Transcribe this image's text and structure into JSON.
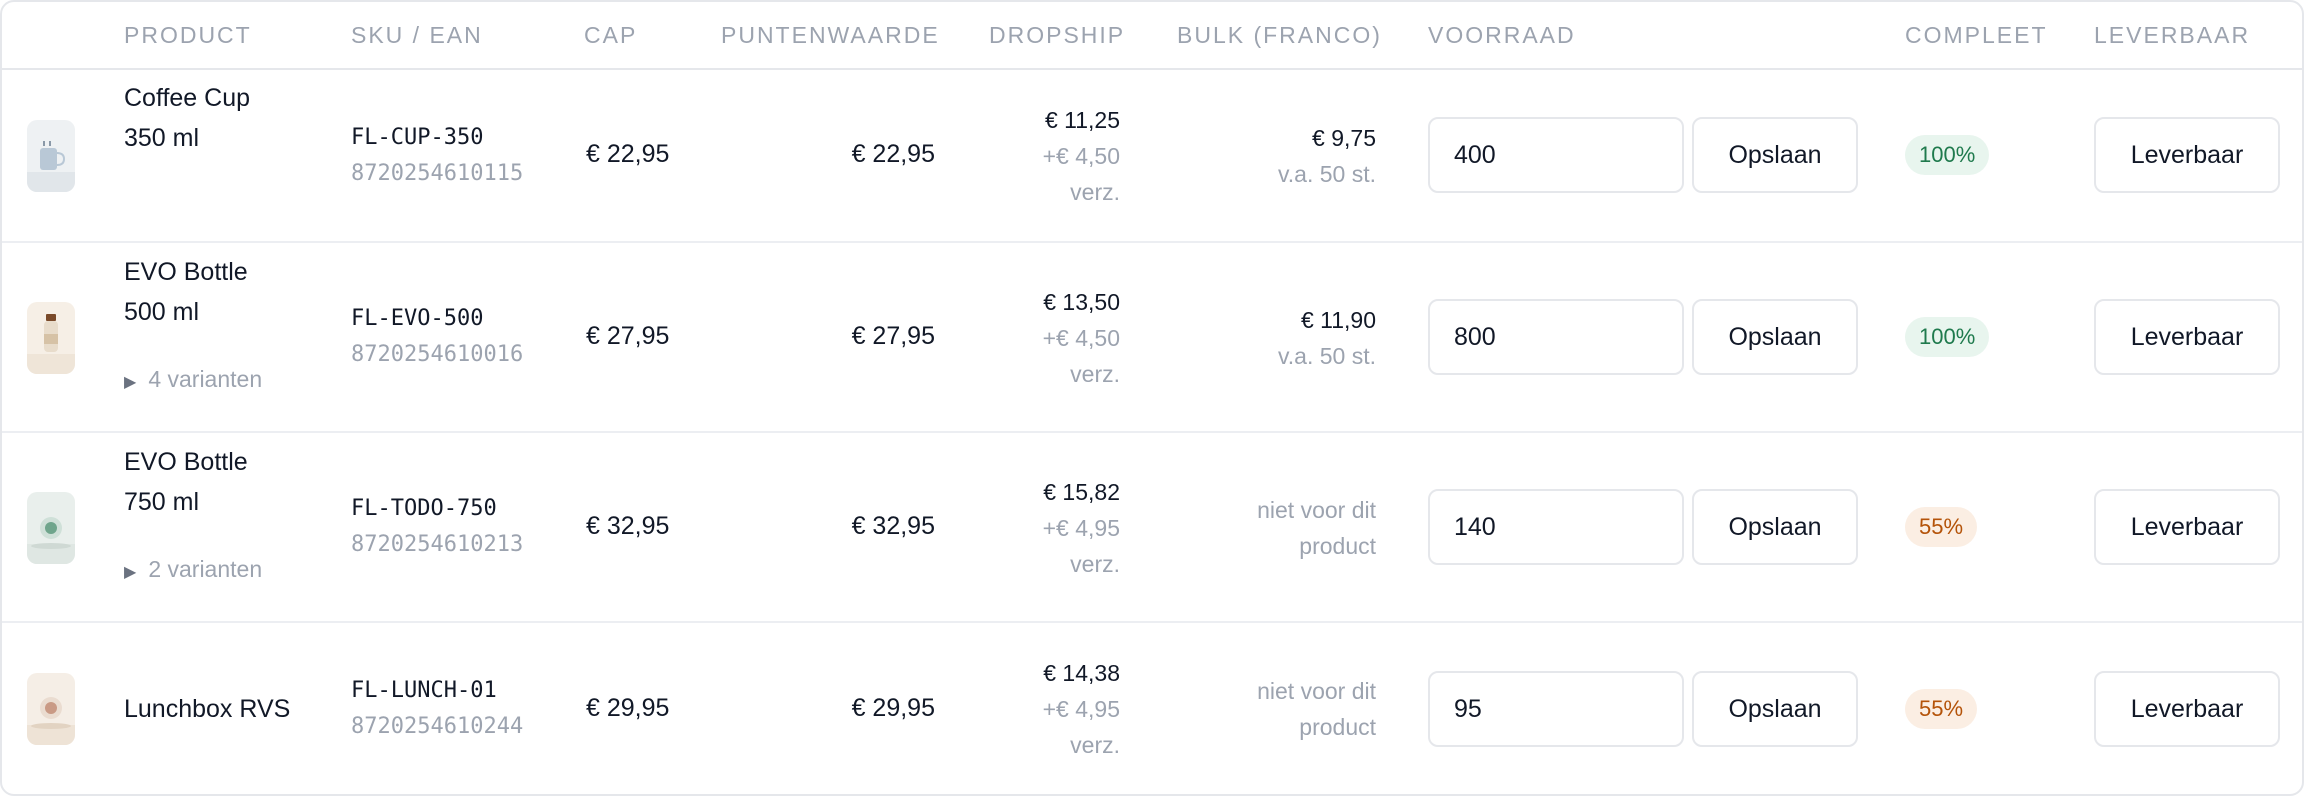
{
  "colors": {
    "header_text": "#9ca3af",
    "badge_complete_bg": "#e8f5ee",
    "badge_complete_text": "#1f7a4d",
    "badge_partial_bg": "#fbeee3",
    "badge_partial_text": "#b45309"
  },
  "header": {
    "product": "PRODUCT",
    "sku": "SKU / EAN",
    "cap": "CAP",
    "points": "PUNTENWAARDE",
    "dropship": "DROPSHIP",
    "bulk": "BULK (FRANCO)",
    "stock": "VOORRAAD",
    "complete": "COMPLEET",
    "available": "LEVERBAAR"
  },
  "rows": [
    {
      "thumb_icon": "coffee-cup-icon",
      "name_line1": "Coffee Cup",
      "name_line2": "350 ml",
      "variants": "",
      "sku": "FL-CUP-350",
      "ean": "8720254610115",
      "cap": "€ 22,95",
      "points": "€ 22,95",
      "dropship_price": "€ 11,25",
      "dropship_ship": "+€ 4,50",
      "dropship_ship2": "verz.",
      "bulk_line1": "€ 9,75",
      "bulk_line2": "v.a. 50 st.",
      "stock": "400",
      "save_label": "Opslaan",
      "complete": "100%",
      "complete_state": "full",
      "available_label": "Leverbaar"
    },
    {
      "thumb_icon": "bottle-icon",
      "name_line1": "EVO Bottle",
      "name_line2": "500 ml",
      "variants": "4 varianten",
      "sku": "FL-EVO-500",
      "ean": "8720254610016",
      "cap": "€ 27,95",
      "points": "€ 27,95",
      "dropship_price": "€ 13,50",
      "dropship_ship": "+€ 4,50",
      "dropship_ship2": "verz.",
      "bulk_line1": "€ 11,90",
      "bulk_line2": "v.a. 50 st.",
      "stock": "800",
      "save_label": "Opslaan",
      "complete": "100%",
      "complete_state": "full",
      "available_label": "Leverbaar"
    },
    {
      "thumb_icon": "bottle-top-view-icon",
      "name_line1": "EVO Bottle",
      "name_line2": "750 ml",
      "variants": "2 varianten",
      "sku": "FL-TODO-750",
      "ean": "8720254610213",
      "cap": "€ 32,95",
      "points": "€ 32,95",
      "dropship_price": "€ 15,82",
      "dropship_ship": "+€ 4,95",
      "dropship_ship2": "verz.",
      "bulk_line1": "niet voor dit",
      "bulk_line2": "product",
      "stock": "140",
      "save_label": "Opslaan",
      "complete": "55%",
      "complete_state": "partial",
      "available_label": "Leverbaar"
    },
    {
      "thumb_icon": "lunchbox-icon",
      "name_line1": "Lunchbox RVS",
      "name_line2": "",
      "variants": "",
      "sku": "FL-LUNCH-01",
      "ean": "8720254610244",
      "cap": "€ 29,95",
      "points": "€ 29,95",
      "dropship_price": "€ 14,38",
      "dropship_ship": "+€ 4,95",
      "dropship_ship2": "verz.",
      "bulk_line1": "niet voor dit",
      "bulk_line2": "product",
      "stock": "95",
      "save_label": "Opslaan",
      "complete": "55%",
      "complete_state": "partial",
      "available_label": "Leverbaar"
    }
  ]
}
